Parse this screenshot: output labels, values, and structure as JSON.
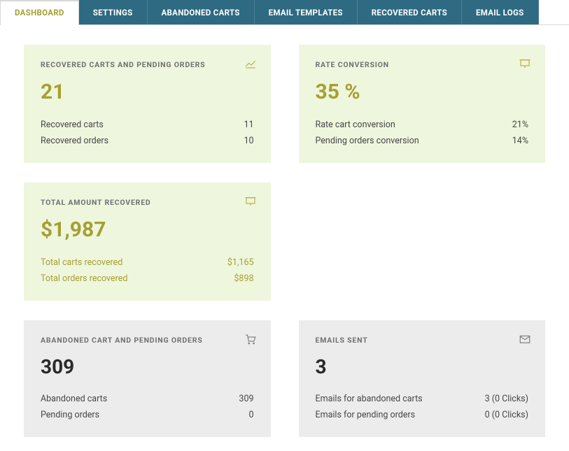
{
  "tabs": {
    "dashboard": "DASHBOARD",
    "settings": "SETTINGS",
    "abandoned": "ABANDONED CARTS",
    "templates": "EMAIL TEMPLATES",
    "recovered": "RECOVERED CARTS",
    "logs": "EMAIL LOGS"
  },
  "cards": {
    "recovered_pending": {
      "title": "RECOVERED CARTS AND PENDING ORDERS",
      "big": "21",
      "row1_label": "Recovered carts",
      "row1_value": "11",
      "row2_label": "Recovered orders",
      "row2_value": "10"
    },
    "rate_conversion": {
      "title": "RATE CONVERSION",
      "big": "35 %",
      "row1_label": "Rate cart conversion",
      "row1_value": "21%",
      "row2_label": "Pending orders conversion",
      "row2_value": "14%"
    },
    "total_amount": {
      "title": "TOTAL AMOUNT RECOVERED",
      "big": "$1,987",
      "row1_label": "Total carts recovered",
      "row1_value": "$1,165",
      "row2_label": "Total orders recovered",
      "row2_value": "$898"
    },
    "abandoned_pending": {
      "title": "ABANDONED CART AND PENDING ORDERS",
      "big": "309",
      "row1_label": "Abandoned carts",
      "row1_value": "309",
      "row2_label": "Pending orders",
      "row2_value": "0"
    },
    "emails_sent": {
      "title": "EMAILS SENT",
      "big": "3",
      "row1_label": "Emails for abandoned carts",
      "row1_value": "3 (0 Clicks)",
      "row2_label": "Emails for pending orders",
      "row2_value": "0 (0 Clicks)"
    }
  }
}
